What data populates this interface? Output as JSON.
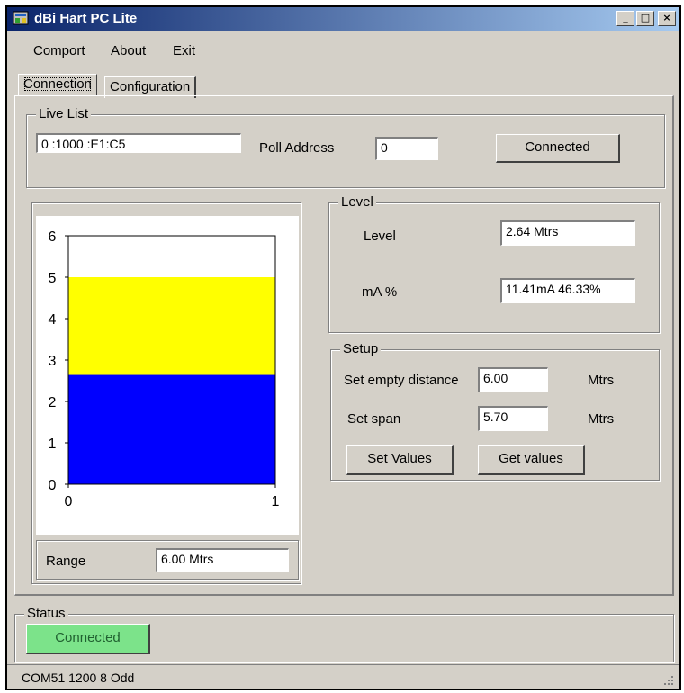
{
  "window": {
    "title": "dBi Hart PC Lite"
  },
  "window_controls": {
    "minimize": "_",
    "maximize": "□",
    "close": "×"
  },
  "menu": {
    "items": [
      "Comport",
      "About",
      "Exit"
    ]
  },
  "tabs": [
    {
      "label": "Connection",
      "active": true
    },
    {
      "label": "Configuration",
      "active": false
    }
  ],
  "live_list": {
    "title": "Live List",
    "entry": "0 :1000   :E1:C5",
    "poll_address_label": "Poll Address",
    "poll_address_value": "0",
    "connected_button": "Connected"
  },
  "chart_data": {
    "type": "bar",
    "title": "",
    "xlabel": "",
    "ylabel": "",
    "xlim": [
      0,
      1
    ],
    "ylim": [
      0,
      6
    ],
    "x_ticks": [
      "0",
      "1"
    ],
    "y_ticks": [
      "0",
      "1",
      "2",
      "3",
      "4",
      "5",
      "6"
    ],
    "grid": false,
    "series": [
      {
        "values": [
          2.64
        ],
        "color": "#0000ff"
      },
      {
        "values": [
          5.0
        ],
        "color": "#ffff00"
      }
    ]
  },
  "range": {
    "label": "Range",
    "value": "6.00  Mtrs"
  },
  "level": {
    "title": "Level",
    "level_label": "Level",
    "level_value": "2.64  Mtrs",
    "ma_label": "mA %",
    "ma_value": "11.41mA 46.33%"
  },
  "setup": {
    "title": "Setup",
    "empty_label": "Set empty distance",
    "empty_value": "6.00",
    "empty_unit": "Mtrs",
    "span_label": "Set span",
    "span_value": "5.70",
    "span_unit": "Mtrs",
    "set_button": "Set Values",
    "get_button": "Get values"
  },
  "status": {
    "title": "Status",
    "state": "Connected",
    "state_color": "#7ce38a",
    "port_info": "COM51  1200 8 Odd"
  }
}
